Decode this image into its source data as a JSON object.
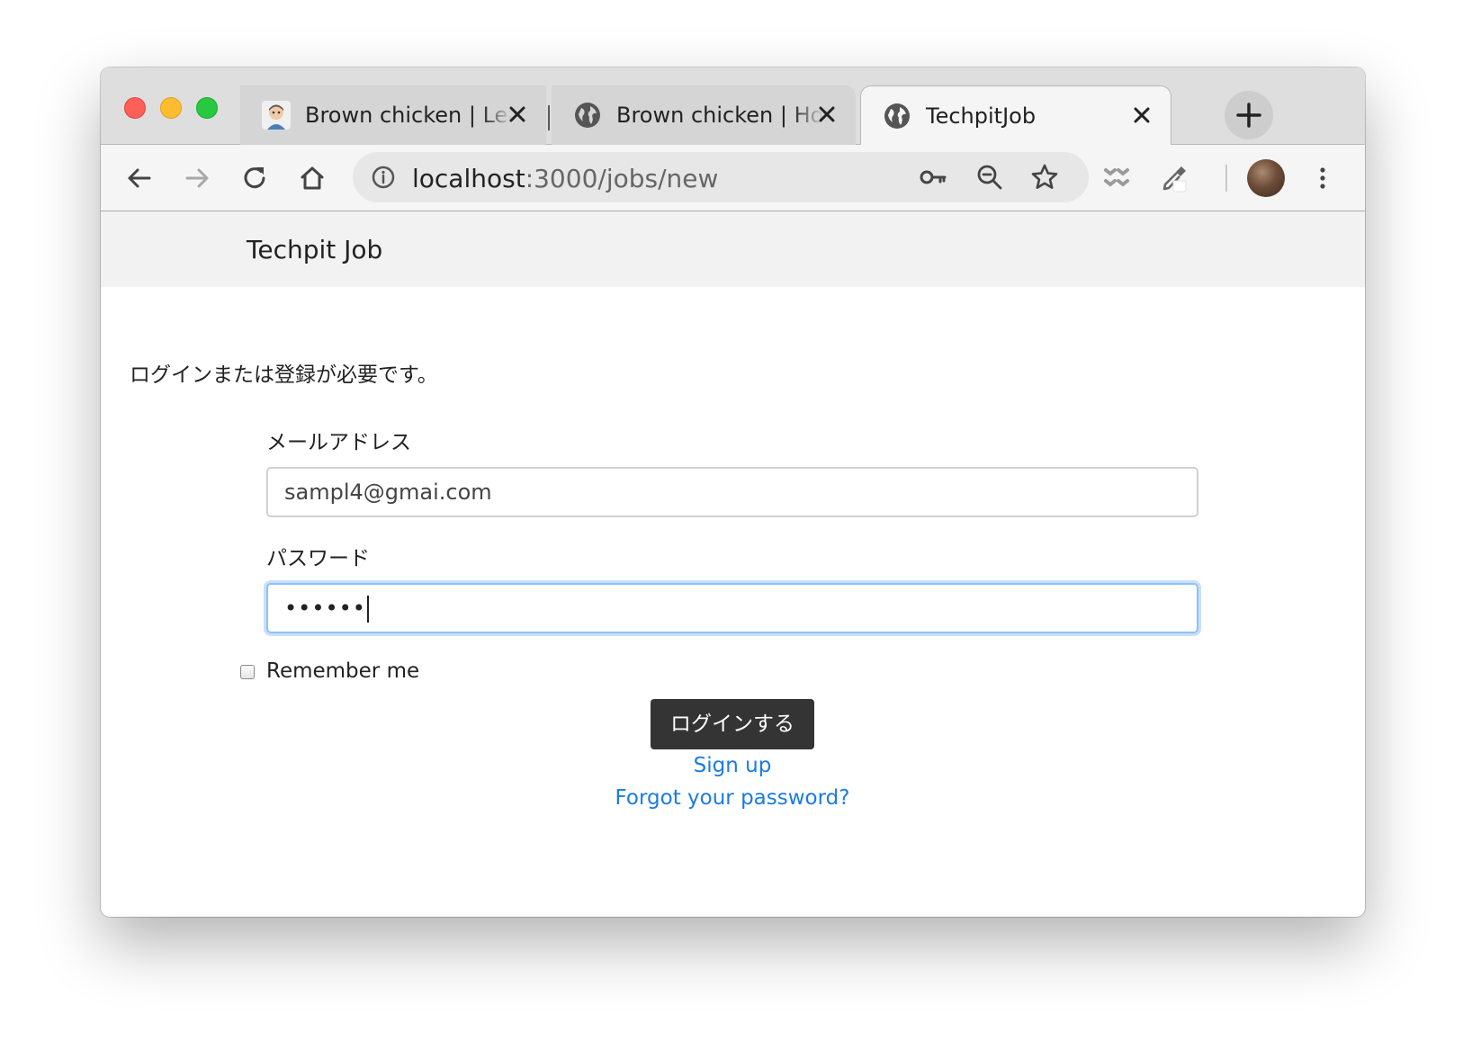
{
  "tabs": [
    {
      "title": "Brown chicken | Lea",
      "favicon": "avatar-favicon-icon",
      "active": false
    },
    {
      "title": "Brown chicken | Hon",
      "favicon": "globe-icon",
      "active": false
    },
    {
      "title": "TechpitJob",
      "favicon": "globe-icon",
      "active": true
    }
  ],
  "address_bar": {
    "host": "localhost",
    "path": ":3000/jobs/new"
  },
  "page": {
    "brand": "Techpit Job",
    "alert": "ログインまたは登録が必要です。",
    "email": {
      "label": "メールアドレス",
      "value": "sampl4@gmai.com"
    },
    "password": {
      "label": "パスワード",
      "masked_value": "••••••"
    },
    "remember_me": {
      "label": "Remember me",
      "checked": false
    },
    "submit_label": "ログインする",
    "links": {
      "sign_up": "Sign up",
      "forgot_password": "Forgot your password?"
    }
  },
  "colors": {
    "primary_button": "#343434",
    "link": "#1a7ce4",
    "focus_border": "#8fc1f5",
    "navbar_bg": "#f2f2f3"
  }
}
